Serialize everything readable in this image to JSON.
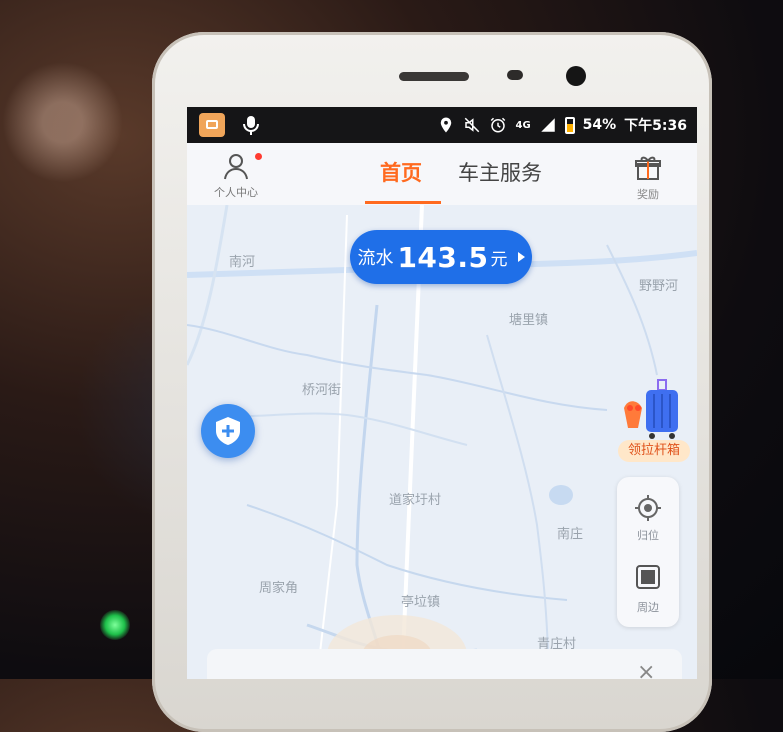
{
  "status_bar": {
    "battery": "54%",
    "time": "下午5:36",
    "network": "4G",
    "icons": [
      "app-icon",
      "microphone-icon",
      "location-icon",
      "mute-icon",
      "alarm-icon",
      "signal-icon",
      "battery-icon"
    ]
  },
  "nav": {
    "profile_label": "个人中心",
    "tabs": [
      {
        "label": "首页",
        "active": true
      },
      {
        "label": "车主服务",
        "active": false
      }
    ],
    "reward_label": "奖励"
  },
  "map": {
    "labels": [
      "南河",
      "野野河",
      "塘里镇",
      "桥河街",
      "道家圩村",
      "南庄",
      "周家角",
      "亭垃镇",
      "青庄村"
    ]
  },
  "income": {
    "label": "流水",
    "amount": "143.5",
    "unit": "元"
  },
  "promo": {
    "label": "领拉杆箱"
  },
  "side_controls": {
    "locate_label": "归位",
    "nearby_label": "周边"
  },
  "bottom": {
    "close_symbol": "×"
  },
  "colors": {
    "accent": "#ff6a1f",
    "primary_blue": "#1f6fe8"
  }
}
